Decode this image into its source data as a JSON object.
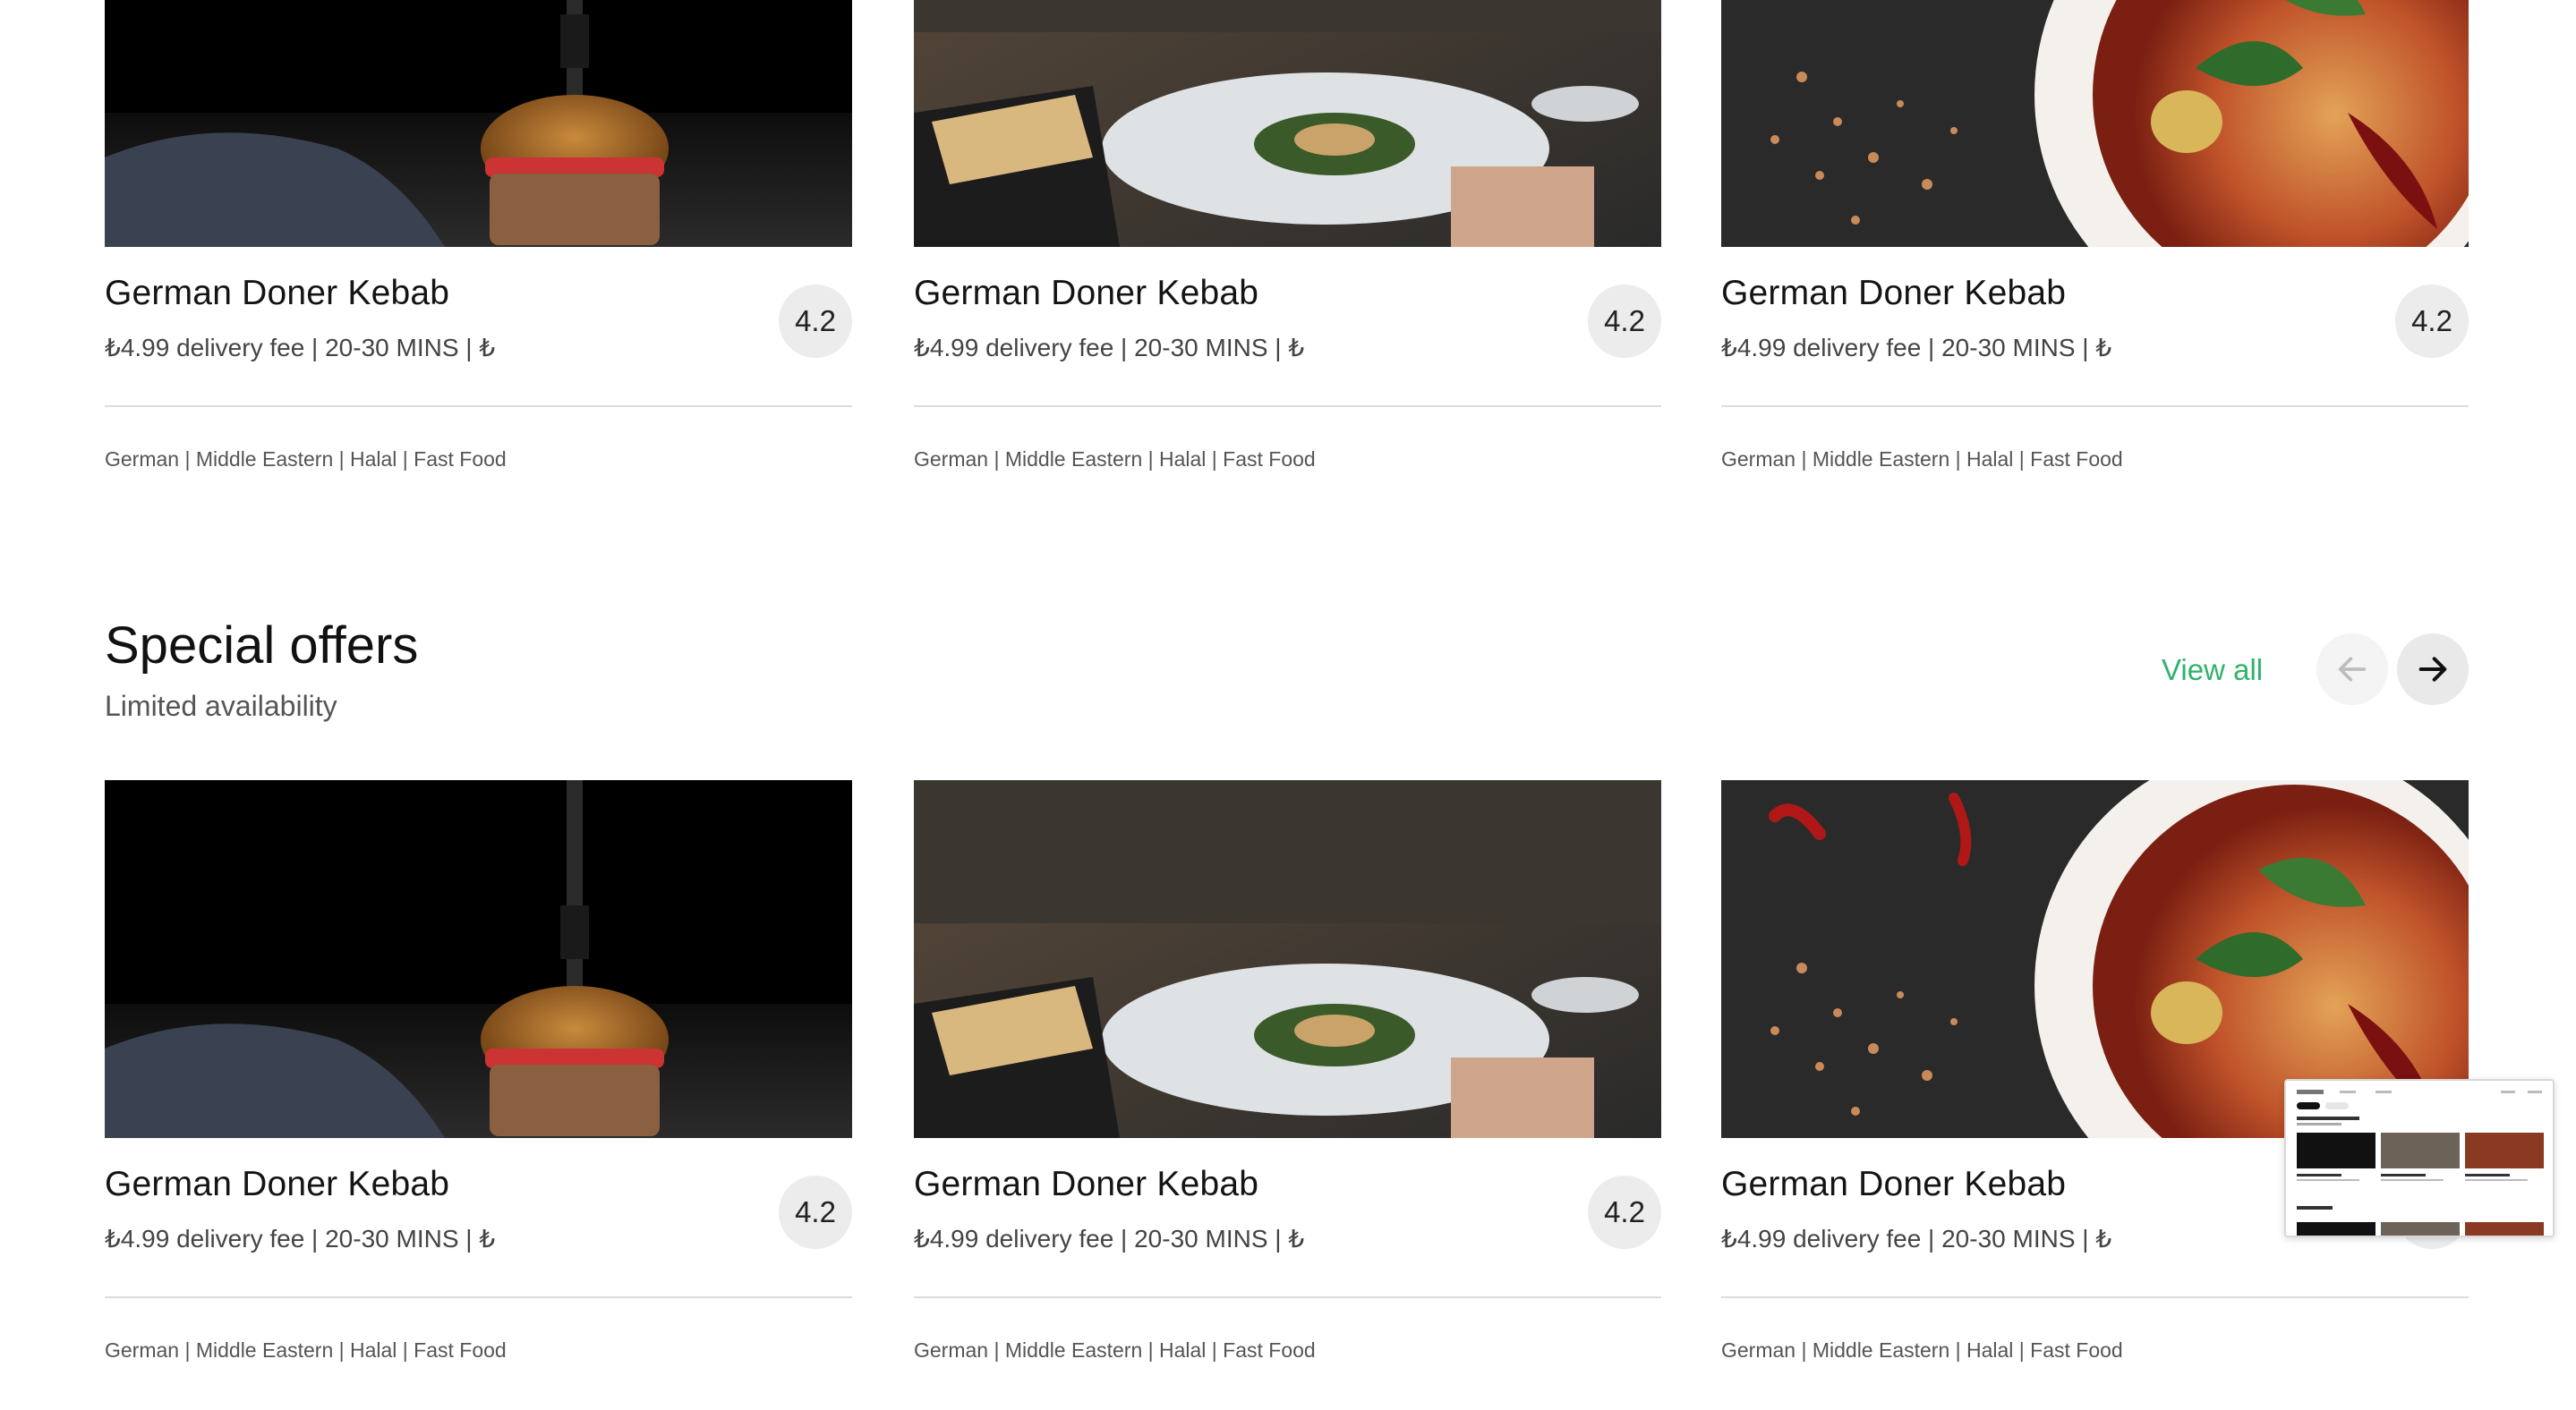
{
  "top_cards": [
    {
      "image": "burger-photo",
      "name": "German Doner Kebab",
      "meta": "₺4.99 delivery fee | 20-30 MINS | ₺",
      "rating": "4.2",
      "tags": "German | Middle Eastern | Halal | Fast Food"
    },
    {
      "image": "restaurant-plate-photo",
      "name": "German Doner Kebab",
      "meta": "₺4.99 delivery fee | 20-30 MINS | ₺",
      "rating": "4.2",
      "tags": "German | Middle Eastern | Halal | Fast Food"
    },
    {
      "image": "curry-bowl-photo",
      "name": "German Doner Kebab",
      "meta": "₺4.99 delivery fee | 20-30 MINS | ₺",
      "rating": "4.2",
      "tags": "German | Middle Eastern | Halal | Fast Food"
    }
  ],
  "special_offers": {
    "title": "Special offers",
    "subtitle": "Limited availability",
    "view_all": "View all",
    "cards": [
      {
        "image": "burger-photo",
        "name": "German Doner Kebab",
        "meta": "₺4.99 delivery fee | 20-30 MINS | ₺",
        "rating": "4.2",
        "tags": "German | Middle Eastern | Halal | Fast Food"
      },
      {
        "image": "restaurant-plate-photo",
        "name": "German Doner Kebab",
        "meta": "₺4.99 delivery fee | 20-30 MINS | ₺",
        "rating": "4.2",
        "tags": "German | Middle Eastern | Halal | Fast Food"
      },
      {
        "image": "curry-bowl-photo",
        "name": "German Doner Kebab",
        "meta": "₺4.99 delivery fee | 20-30 MINS | ₺",
        "rating": "4.2",
        "tags": "German | Middle Eastern | Halal | Fast Food"
      }
    ]
  },
  "colors": {
    "accent": "#2db36a",
    "rating_bg": "#ececec",
    "divider": "#dcdcdc"
  },
  "icons": {
    "prev": "arrow-left-icon",
    "next": "arrow-right-icon"
  }
}
